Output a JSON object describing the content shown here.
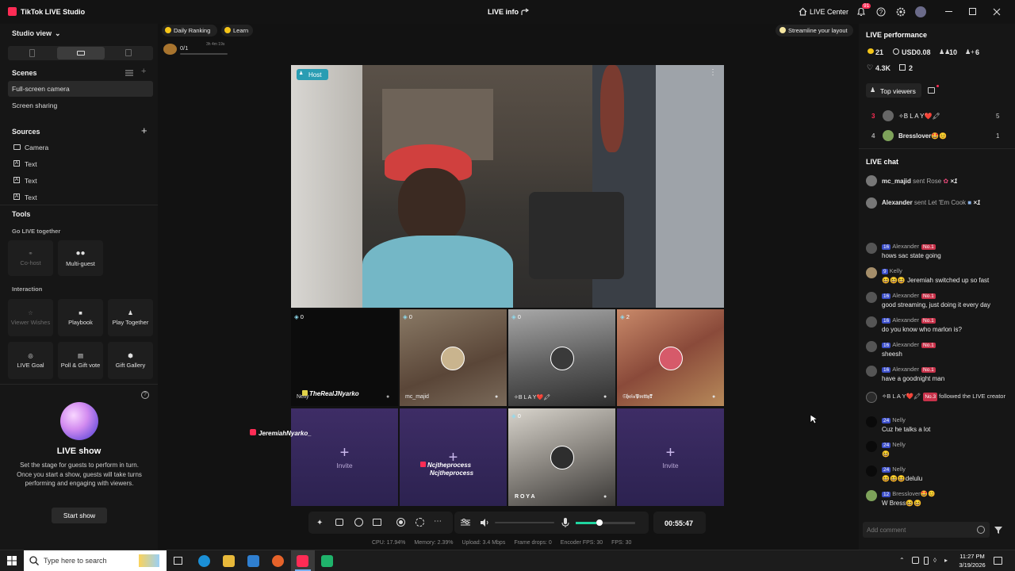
{
  "titlebar": {
    "app_name": "TikTok LIVE Studio",
    "center_title": "LIVE info",
    "live_center": "LIVE Center",
    "notif_count": "91"
  },
  "left": {
    "studio_view": "Studio view",
    "scenes_title": "Scenes",
    "scenes": [
      "Full-screen camera",
      "Screen sharing"
    ],
    "sources_title": "Sources",
    "sources": [
      "Camera",
      "Text",
      "Text",
      "Text"
    ],
    "tools_title": "Tools",
    "go_live_together": "Go LIVE together",
    "co_host": "Co-host",
    "multi_guest": "Multi-guest",
    "interaction": "Interaction",
    "viewer_wishes": "Viewer Wishes",
    "playbook": "Playbook",
    "play_together": "Play Together",
    "live_goal": "LIVE Goal",
    "poll_gift_vote": "Poll & Gift vote",
    "gift_gallery": "Gift Gallery",
    "live_show_title": "LIVE show",
    "live_show_desc": "Set the stage for guests to perform in turn. Once you start a show, guests will take turns performing and engaging with viewers.",
    "start_show": "Start show"
  },
  "center": {
    "daily_ranking": "Daily Ranking",
    "learn": "Learn",
    "goal_count": "0/1",
    "goal_time": "3h 4m 19s",
    "streamline": "Streamline your layout",
    "host_label": "Host",
    "overlay_user": "JeremiahNyarko_",
    "guests": [
      {
        "count": "0",
        "name": "Nelly",
        "overlay": "TheRealJNyarko"
      },
      {
        "count": "0",
        "name": "mc_majid"
      },
      {
        "count": "0",
        "name": "✧B L A Y❤️🖍"
      },
      {
        "count": "2",
        "name": "𝕾𝖍𝖊𝖎𝖘𝕻𝖗𝖊𝖙𝖙𝖞❣"
      },
      {
        "label": "Invite"
      },
      {
        "overlay1": "Ncjtheprocess",
        "overlay2": "Ncjtheprocess"
      },
      {
        "count": "0",
        "name": "R O Y A"
      },
      {
        "label": "Invite"
      }
    ],
    "timer": "00:55:47",
    "volume_level": 0.0,
    "mic_level": 0.35,
    "stats": {
      "cpu": "CPU: 17.94%",
      "memory": "Memory: 2.39%",
      "upload": "Upload: 3.4 Mbps",
      "frame_drops": "Frame drops: 0",
      "encoder_fps": "Encoder FPS: 30",
      "fps": "FPS: 30"
    }
  },
  "right": {
    "perf_title": "LIVE performance",
    "coins": "21",
    "usd": "USD0.08",
    "viewers": "10",
    "diamonds_metric": "6",
    "likes": "4.3K",
    "gifts": "2",
    "top_viewers": "Top viewers",
    "rank3_num": "3",
    "rank3_name": "✧B L A Y❤️🖍",
    "rank3_val": "5",
    "rank4_num": "4",
    "rank4_name": "Bresslover🤩😊",
    "rank4_val": "1",
    "chat_title": "LIVE chat",
    "gift1_user": "mc_majid",
    "gift1_text": "sent Rose",
    "gift1_count": "×1",
    "gift2_user": "Alexander",
    "gift2_text": "sent Let 'Em Cook",
    "gift2_count": "×1",
    "messages": [
      {
        "badge": "16",
        "user": "Alexander",
        "no": "No.1",
        "text": "hows sac state going"
      },
      {
        "badge": "9",
        "user": "Kelly",
        "no": "",
        "text": "😆😆😆 Jeremiah switched up so fast"
      },
      {
        "badge": "16",
        "user": "Alexander",
        "no": "No.1",
        "text": "good streaming, just doing it every day"
      },
      {
        "badge": "16",
        "user": "Alexander",
        "no": "No.1",
        "text": "do you know who marlon is?"
      },
      {
        "badge": "16",
        "user": "Alexander",
        "no": "No.1",
        "text": "sheesh"
      },
      {
        "badge": "16",
        "user": "Alexander",
        "no": "No.1",
        "text": "have a goodnight man"
      },
      {
        "badge": "",
        "user": "✧B L A Y❤️🖍",
        "no": "No.3",
        "text": "followed the LIVE creator"
      },
      {
        "badge": "24",
        "user": "Nelly",
        "no": "",
        "text": "Cuz he talks a lot"
      },
      {
        "badge": "24",
        "user": "Nelly",
        "no": "",
        "text": "😆"
      },
      {
        "badge": "24",
        "user": "Nelly",
        "no": "",
        "text": "😆😆😆delulu"
      },
      {
        "badge": "12",
        "user": "Bresslover🤩😊",
        "no": "",
        "text": "W Bress😆😆"
      }
    ],
    "comment_placeholder": "Add comment"
  },
  "taskbar": {
    "search_placeholder": "Type here to search",
    "time": "11:27 PM",
    "date": "3/19/2026"
  },
  "colors": {
    "tiktok_red": "#fe2c55",
    "accent_green": "#20d5a0",
    "tile_purple": "#3a2960",
    "badge_blue": "#3b4ec8"
  }
}
